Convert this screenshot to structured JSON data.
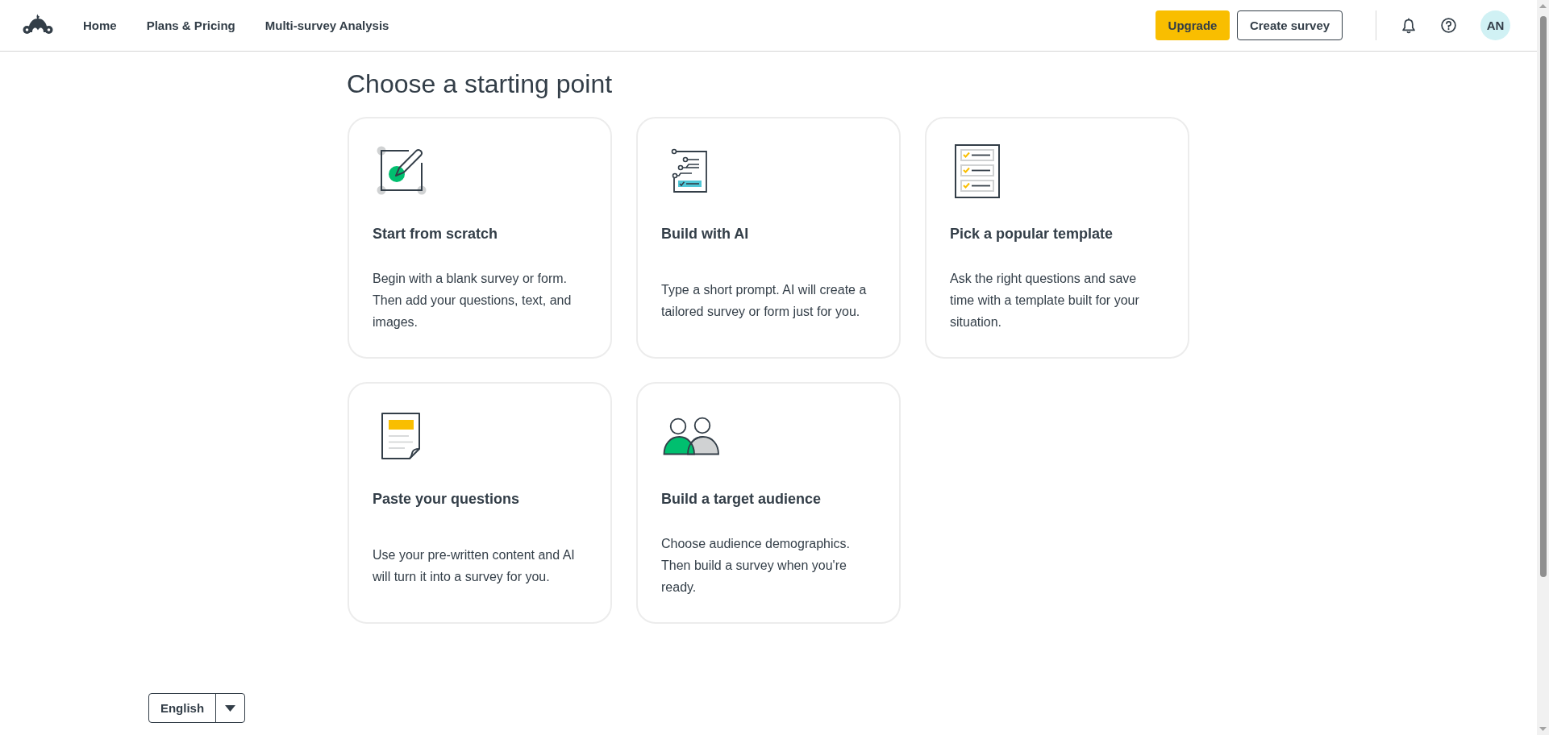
{
  "nav": {
    "items": [
      {
        "label": "Home"
      },
      {
        "label": "Plans & Pricing"
      },
      {
        "label": "Multi-survey Analysis"
      }
    ]
  },
  "actions": {
    "upgrade": "Upgrade",
    "create": "Create survey"
  },
  "user": {
    "initials": "AN"
  },
  "page": {
    "title": "Choose a starting point"
  },
  "cards": [
    {
      "kind": "scratch",
      "title": "Start from scratch",
      "description": "Begin with a blank survey or form. Then add your questions, text, and images."
    },
    {
      "kind": "ai",
      "title": "Build with AI",
      "description": "Type a short prompt. AI will create a tailored survey or form just for you."
    },
    {
      "kind": "template",
      "title": "Pick a popular template",
      "description": "Ask the right questions and save time with a template built for your situation."
    },
    {
      "kind": "paste",
      "title": "Paste your questions",
      "description": "Use your pre-written content and AI will turn it into a survey for you."
    },
    {
      "kind": "audience",
      "title": "Build a target audience",
      "description": "Choose audience demographics. Then build a survey when you're ready."
    }
  ],
  "footer": {
    "language": "English"
  }
}
